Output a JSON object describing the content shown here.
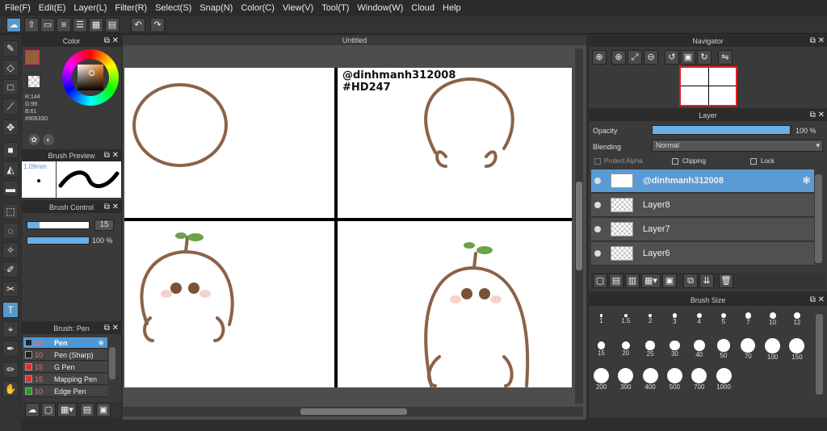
{
  "menu": [
    "File(F)",
    "Edit(E)",
    "Layer(L)",
    "Filter(R)",
    "Select(S)",
    "Snap(N)",
    "Color(C)",
    "View(V)",
    "Tool(T)",
    "Window(W)",
    "Cloud",
    "Help"
  ],
  "document": {
    "title": "Untitled"
  },
  "watermark": {
    "line1": "@dinhmanh312008",
    "line2": "#HD247"
  },
  "color_panel": {
    "title": "Color",
    "r": "R:144",
    "g": "G:99",
    "b": "B:61",
    "hex": "#90633D",
    "fg": "#90633D"
  },
  "brush_preview": {
    "title": "Brush Preview",
    "size": "1.09mm"
  },
  "brush_control": {
    "title": "Brush Control",
    "size_value": "15",
    "opacity_value": "100 %",
    "size_level": 0.2,
    "opacity_level": 1.0
  },
  "brush_list": {
    "title": "Brush: Pen",
    "items": [
      {
        "size": "15",
        "name": "Pen",
        "color": "#222222",
        "selected": true
      },
      {
        "size": "10",
        "name": "Pen (Sharp)",
        "color": "#222222",
        "selected": false
      },
      {
        "size": "15",
        "name": "G Pen",
        "color": "#e03030",
        "selected": false
      },
      {
        "size": "15",
        "name": "Mapping Pen",
        "color": "#e03030",
        "selected": false
      },
      {
        "size": "10",
        "name": "Edge Pen",
        "color": "#20a020",
        "selected": false
      }
    ]
  },
  "navigator": {
    "title": "Navigator"
  },
  "layer_panel": {
    "title": "Layer",
    "opacity_label": "Opacity",
    "opacity_value": "100 %",
    "opacity_level": 1.0,
    "blending_label": "Blending",
    "blending_value": "Normal",
    "protect_alpha": "Protect Alpha",
    "clipping": "Clipping",
    "lock": "Lock",
    "layers": [
      {
        "name": "@dinhmanh312008",
        "selected": true
      },
      {
        "name": "Layer8",
        "selected": false
      },
      {
        "name": "Layer7",
        "selected": false
      },
      {
        "name": "Layer6",
        "selected": false
      }
    ]
  },
  "brush_size": {
    "title": "Brush Size",
    "sizes": [
      "1",
      "1.5",
      "2",
      "3",
      "4",
      "5",
      "7",
      "10",
      "12",
      "15",
      "20",
      "25",
      "30",
      "40",
      "50",
      "70",
      "100",
      "150",
      "200",
      "300",
      "400",
      "500",
      "700",
      "1000"
    ]
  },
  "colors": {
    "accent": "#5b9bd5",
    "stroke": "#8b6248"
  }
}
